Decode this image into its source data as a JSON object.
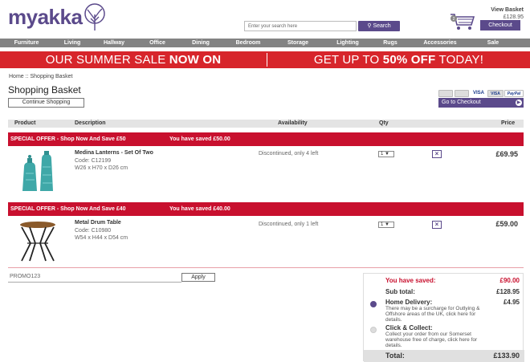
{
  "header": {
    "logo": "myakka",
    "search_placeholder": "Enter your search here",
    "search_label": "Search",
    "view_basket": "View Basket",
    "basket_total": "£128.95",
    "checkout_label": "Checkout"
  },
  "nav": [
    "Furniture",
    "Living",
    "Hallway",
    "Office",
    "Dining",
    "Bedroom",
    "Storage",
    "Lighting",
    "Rugs",
    "Accessories",
    "Sale"
  ],
  "banner": {
    "left_pre": "OUR SUMMER SALE ",
    "left_bold": "NOW ON",
    "right_pre": "GET UP TO ",
    "right_bold": "50% OFF",
    "right_post": " TODAY!"
  },
  "breadcrumb": {
    "home": "Home",
    "sep": "::",
    "current": "Shopping Basket"
  },
  "page_title": "Shopping Basket",
  "continue_label": "Continue Shopping",
  "payment_cards": [
    "mastercard-icon",
    "maestro-icon",
    "visa-icon",
    "visa-electron-icon",
    "paypal-icon"
  ],
  "payment_labels": [
    "",
    "",
    "VISA",
    "VISA",
    "PayPal"
  ],
  "goto_checkout": "Go to Checkout",
  "columns": {
    "product": "Product",
    "description": "Description",
    "availability": "Availability",
    "qty": "Qty",
    "price": "Price"
  },
  "items": [
    {
      "offer": "SPECIAL OFFER - Shop Now And Save £50",
      "saved": "You have saved £50.00",
      "name": "Medina Lanterns - Set Of Two",
      "code": "Code: C12199",
      "dims": "W26 x H70 x D26 cm",
      "availability": "Discontinued, only 4 left",
      "qty": "1",
      "price": "£69.95"
    },
    {
      "offer": "SPECIAL OFFER - Shop Now And Save £40",
      "saved": "You have saved £40.00",
      "name": "Metal Drum Table",
      "code": "Code: C10980",
      "dims": "W54 x H44 x D54 cm",
      "availability": "Discontinued, only 1 left",
      "qty": "1",
      "price": "£59.00"
    }
  ],
  "promo": {
    "value": "PROMO123",
    "apply_label": "Apply"
  },
  "summary": {
    "saved_label": "You have saved:",
    "saved_value": "£90.00",
    "subtotal_label": "Sub total:",
    "subtotal_value": "£128.95",
    "home_label": "Home Delivery:",
    "home_value": "£4.95",
    "home_note": "There may be a surcharge for Outlying & Offshore areas of the UK, click here for details.",
    "collect_label": "Click & Collect:",
    "collect_note": "Collect your order from our Somerset warehouse free of charge, click here for details.",
    "total_label": "Total:",
    "total_value": "£133.90"
  },
  "colors": {
    "brand": "#5b4a8b",
    "sale": "#d7252b",
    "offer": "#c8102e"
  }
}
